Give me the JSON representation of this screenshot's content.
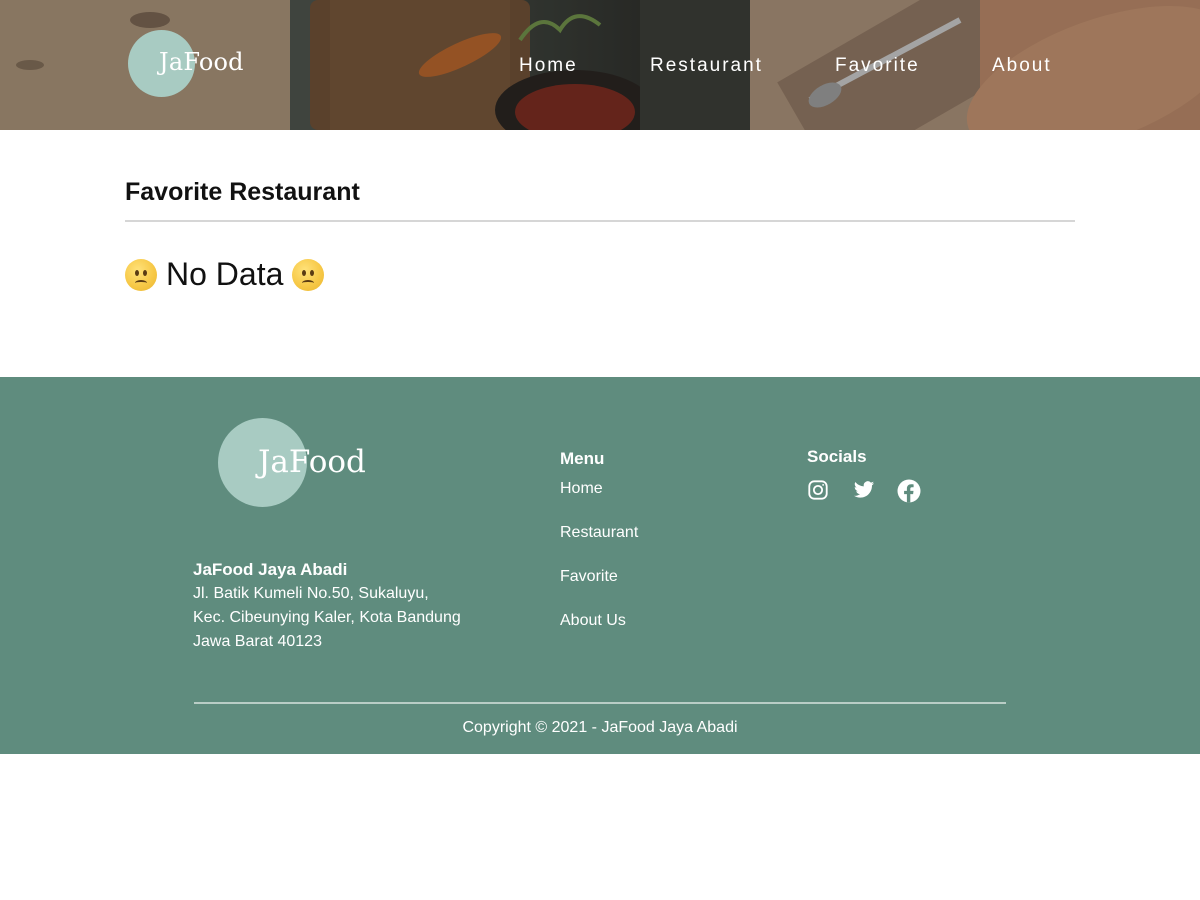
{
  "header": {
    "logo_text": "JaFood",
    "nav": {
      "home": "Home",
      "restaurant": "Restaurant",
      "favorite": "Favorite",
      "about": "About"
    }
  },
  "main": {
    "title": "Favorite Restaurant",
    "empty_message": "No Data"
  },
  "footer": {
    "logo_text": "JaFood",
    "company": {
      "name": "JaFood Jaya Abadi",
      "address_line1": "Jl. Batik Kumeli No.50, Sukaluyu,",
      "address_line2": "Kec. Cibeunying Kaler, Kota Bandung",
      "address_line3": "Jawa Barat 40123"
    },
    "menu": {
      "title": "Menu",
      "items": [
        "Home",
        "Restaurant",
        "Favorite",
        "About Us"
      ]
    },
    "socials": {
      "title": "Socials",
      "icons": [
        "instagram-icon",
        "twitter-icon",
        "facebook-icon"
      ]
    },
    "copyright": "Copyright © 2021 - JaFood Jaya Abadi"
  },
  "colors": {
    "footer_bg": "#5f8c7e",
    "logo_circle": "#a8cbc2"
  }
}
